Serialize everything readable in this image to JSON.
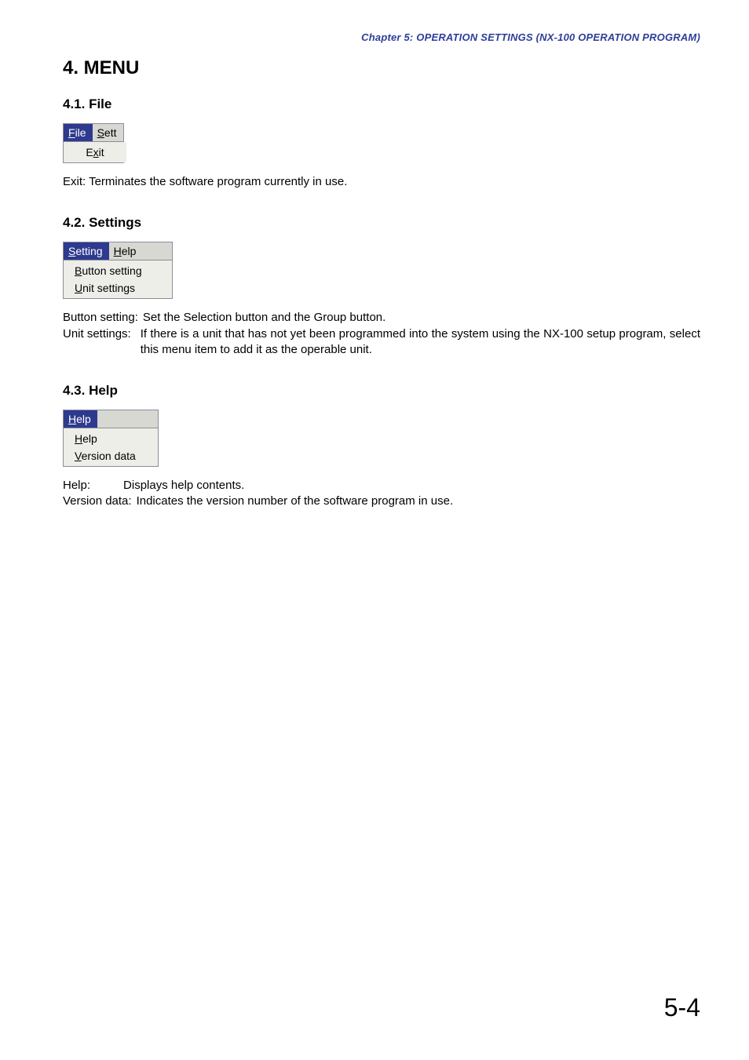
{
  "chapter_header": "Chapter 5:  OPERATION SETTINGS (NX-100 OPERATION PROGRAM)",
  "page_number": "5-4",
  "title": "4. MENU",
  "sections": {
    "file": {
      "heading": "4.1. File",
      "menubar": {
        "file": "File",
        "sett": "Sett"
      },
      "dropdown": {
        "exit": "Exit"
      },
      "description": "Exit: Terminates the software program currently in use."
    },
    "settings": {
      "heading": "4.2. Settings",
      "menubar": {
        "setting": "Setting",
        "help": "Help"
      },
      "dropdown": {
        "button_setting": "Button setting",
        "unit_settings": "Unit settings"
      },
      "descriptions": {
        "button_setting": {
          "label": "Button setting:",
          "text": "Set the Selection button and the Group button."
        },
        "unit_settings": {
          "label": "Unit settings:",
          "text": "If there is a unit that has not yet been programmed into the system using the NX-100 setup program, select this menu item to add it as the operable unit."
        }
      }
    },
    "help": {
      "heading": "4.3. Help",
      "menubar": {
        "help": "Help"
      },
      "dropdown": {
        "help": "Help",
        "version_data": "Version data"
      },
      "descriptions": {
        "help": {
          "label": "Help:",
          "text": "Displays help contents."
        },
        "version_data": {
          "label": "Version data:",
          "text": "Indicates the version number of the software program in use."
        }
      }
    }
  }
}
